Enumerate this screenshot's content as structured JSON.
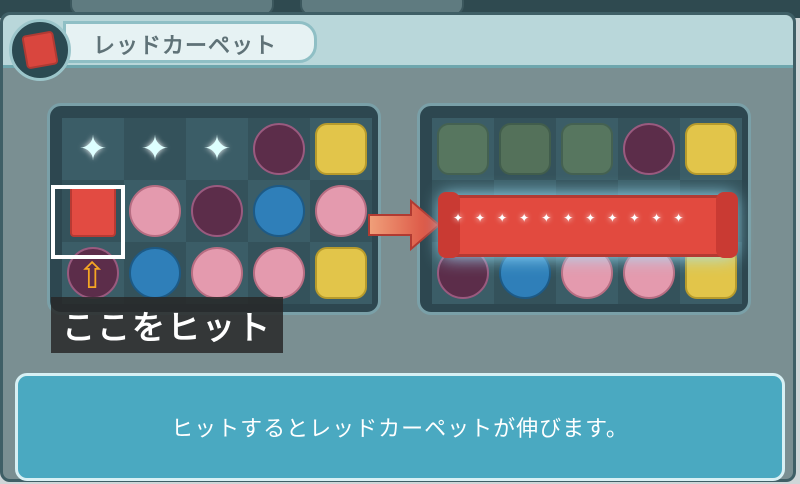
{
  "header": {
    "title": "レッドカーペット"
  },
  "tutorial": {
    "hit_label": "ここをヒット",
    "message": "ヒットするとレッドカーペットが伸びます。"
  },
  "colors": {
    "panel_border": "#3f5f66",
    "message_bg": "#4aa9c1",
    "carpet_red": "#e24a3f",
    "highlight": "#ffffff",
    "arrow": "#f5a623"
  },
  "icons": {
    "title_icon": "red-carpet-icon",
    "sparkle": "sparkle-icon",
    "carpet": "red-carpet-piece-icon",
    "arrow": "right-arrow-icon"
  }
}
